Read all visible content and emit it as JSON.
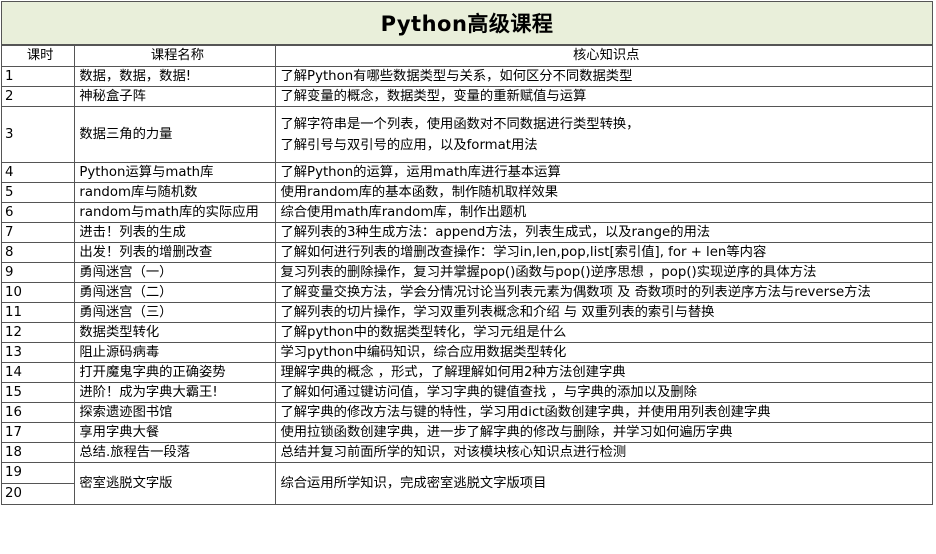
{
  "title": "Python高级课程",
  "headers": [
    "课时",
    "课程名称",
    "核心知识点"
  ],
  "rows": [
    {
      "no": "1",
      "name": "数据，数据，数据!",
      "points": [
        "了解Python有哪些数据类型与关系，如何区分不同数据类型"
      ]
    },
    {
      "no": "2",
      "name": "神秘盒子阵",
      "points": [
        "了解变量的概念，数据类型，变量的重新赋值与运算"
      ]
    },
    {
      "no": "3",
      "name": "数据三角的力量",
      "points": [
        "了解字符串是一个列表，使用函数对不同数据进行类型转换，",
        "了解引号与双引号的应用，以及format用法"
      ]
    },
    {
      "no": "4",
      "name": "Python运算与math库",
      "points": [
        "了解Python的运算，运用math库进行基本运算"
      ]
    },
    {
      "no": "5",
      "name": "random库与随机数",
      "points": [
        "使用random库的基本函数，制作随机取样效果"
      ]
    },
    {
      "no": "6",
      "name": "random与math库的实际应用",
      "points": [
        "综合使用math库random库，制作出题机"
      ]
    },
    {
      "no": "7",
      "name": "进击！列表的生成",
      "points": [
        "了解列表的3种生成方法：append方法，列表生成式，以及range的用法"
      ]
    },
    {
      "no": "8",
      "name": "出发！列表的增删改查",
      "points": [
        "了解如何进行列表的增删改查操作：学习in,len,pop,list[索引值], for + len等内容"
      ]
    },
    {
      "no": "9",
      "name": "勇闯迷宫（一）",
      "points": [
        "复习列表的删除操作，复习并掌握pop()函数与pop()逆序思想 ，pop()实现逆序的具体方法"
      ]
    },
    {
      "no": "10",
      "name": "勇闯迷宫（二）",
      "points": [
        "了解变量交换方法，学会分情况讨论当列表元素为偶数项 及 奇数项时的列表逆序方法与reverse方法"
      ]
    },
    {
      "no": "11",
      "name": "勇闯迷宫（三）",
      "points": [
        "了解列表的切片操作，学习双重列表概念和介绍 与 双重列表的索引与替换"
      ]
    },
    {
      "no": "12",
      "name": "数据类型转化",
      "points": [
        "了解python中的数据类型转化，学习元组是什么"
      ]
    },
    {
      "no": "13",
      "name": "阻止源码病毒",
      "points": [
        "学习python中编码知识，综合应用数据类型转化"
      ]
    },
    {
      "no": "14",
      "name": "打开魔鬼字典的正确姿势",
      "points": [
        "理解字典的概念 ，形式，了解理解如何用2种方法创建字典"
      ]
    },
    {
      "no": "15",
      "name": "进阶！成为字典大霸王!",
      "points": [
        "了解如何通过键访问值，学习字典的键值查找 ，与字典的添加以及删除"
      ]
    },
    {
      "no": "16",
      "name": "探索遗迹图书馆",
      "points": [
        "了解字典的修改方法与键的特性，学习用dict函数创建字典，并使用用列表创建字典"
      ]
    },
    {
      "no": "17",
      "name": "享用字典大餐",
      "points": [
        "使用拉锁函数创建字典，进一步了解字典的修改与删除，并学习如何遍历字典"
      ]
    },
    {
      "no": "18",
      "name": "总结.旅程告一段落",
      "points": [
        "总结并复习前面所学的知识，对该模块核心知识点进行检测"
      ]
    }
  ],
  "merged": {
    "nos": [
      "19",
      "20"
    ],
    "name": "密室逃脱文字版",
    "points": "综合运用所学知识，完成密室逃脱文字版项目"
  }
}
